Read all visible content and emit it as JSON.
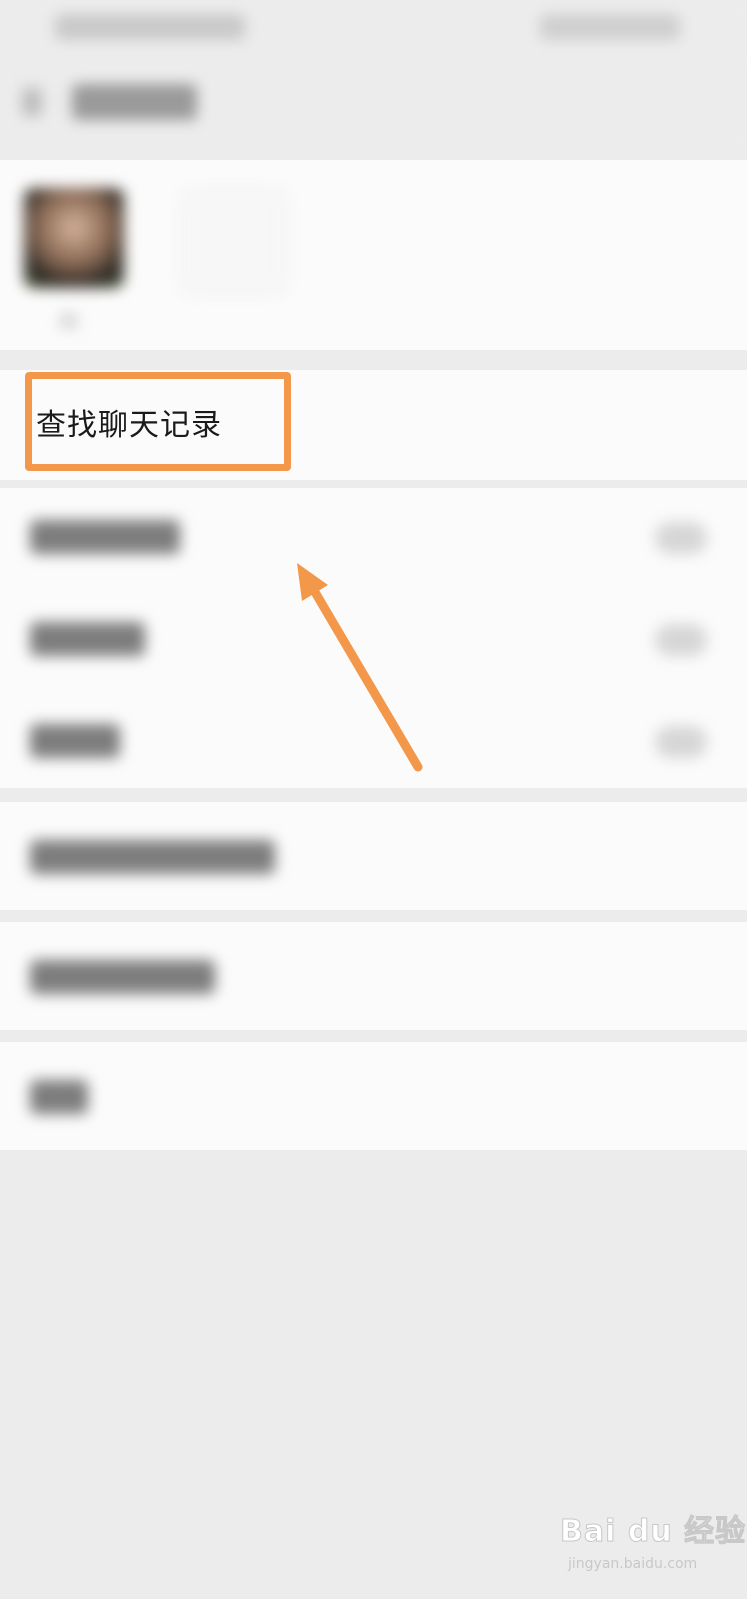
{
  "screen": {
    "background_color": "#ececec",
    "card_color": "#fbfbfb"
  },
  "member": {
    "name_fragment": "妈"
  },
  "search_history": {
    "label": "查找聊天记录"
  },
  "annotation": {
    "highlight_color": "#f3984a",
    "arrow_color": "#f3984a"
  },
  "watermark": {
    "logo_text": "Bai du 经验",
    "url_text": "jingyan.baidu.com"
  }
}
